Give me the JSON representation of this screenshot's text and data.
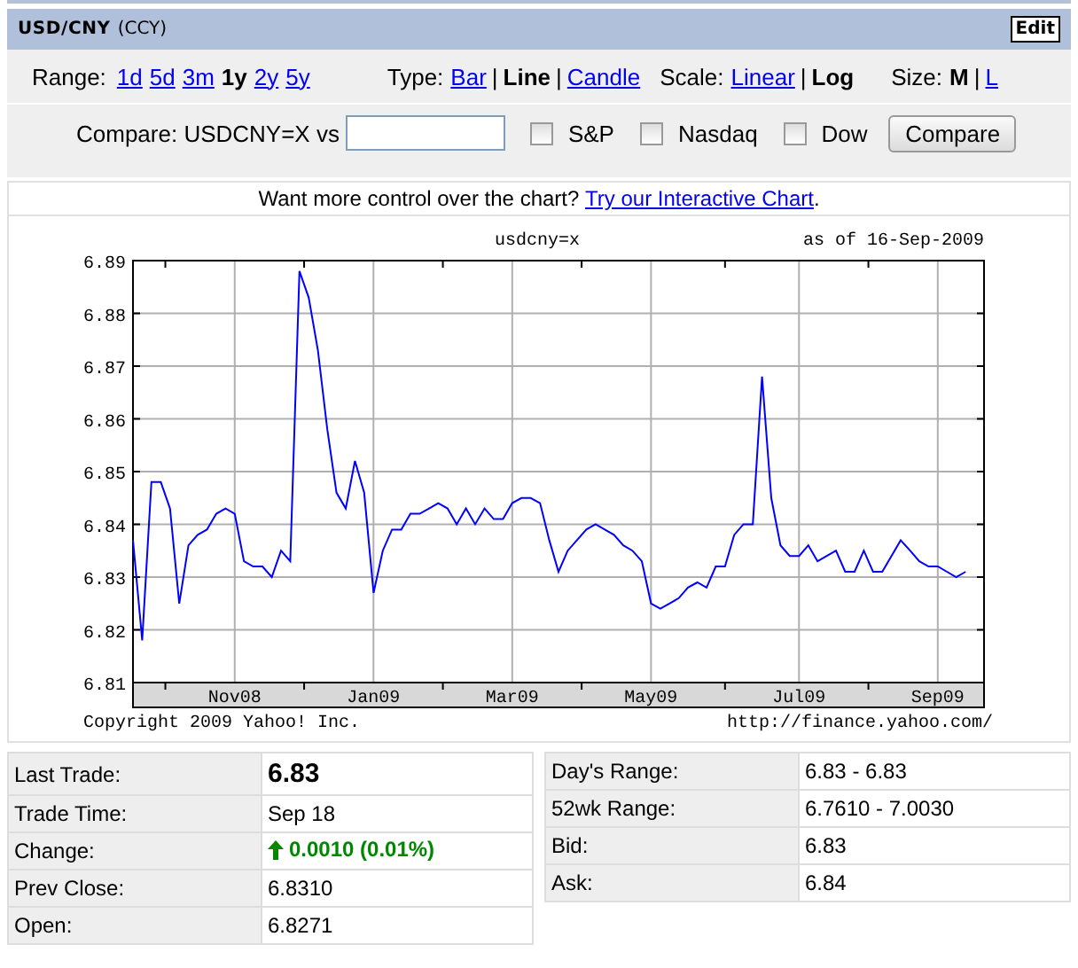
{
  "header": {
    "title": "USD/CNY",
    "subtitle": "(CCY)",
    "edit_button": "Edit"
  },
  "range": {
    "label": "Range:",
    "options": [
      {
        "label": "1d",
        "selected": false
      },
      {
        "label": "5d",
        "selected": false
      },
      {
        "label": "3m",
        "selected": false
      },
      {
        "label": "1y",
        "selected": true
      },
      {
        "label": "2y",
        "selected": false
      },
      {
        "label": "5y",
        "selected": false
      }
    ]
  },
  "chart_type": {
    "label": "Type:",
    "separator": "|",
    "options": [
      {
        "label": "Bar",
        "selected": false
      },
      {
        "label": "Line",
        "selected": true
      },
      {
        "label": "Candle",
        "selected": false
      }
    ]
  },
  "scale": {
    "label": "Scale:",
    "separator": "|",
    "options": [
      {
        "label": "Linear",
        "selected": false
      },
      {
        "label": "Log",
        "selected": true
      }
    ]
  },
  "size": {
    "label": "Size:",
    "separator": "|",
    "options": [
      {
        "label": "M",
        "selected": true
      },
      {
        "label": "L",
        "selected": false
      }
    ]
  },
  "compare": {
    "label": "Compare: USDCNY=X vs",
    "checkboxes": [
      {
        "label": "S&P",
        "checked": false
      },
      {
        "label": "Nasdaq",
        "checked": false
      },
      {
        "label": "Dow",
        "checked": false
      }
    ],
    "button": "Compare"
  },
  "promo": {
    "text": "Want more control over the chart?",
    "link": "Try our Interactive Chart",
    "tail": "."
  },
  "chart": {
    "as_of": "as of 16-Sep-2009",
    "copyright": "Copyright 2009 Yahoo! Inc.",
    "source": "http://finance.yahoo.com/",
    "chart_data": {
      "type": "line",
      "title": "usdcny=x",
      "grid": true,
      "ylim": [
        6.81,
        6.89
      ],
      "yticks": [
        6.81,
        6.82,
        6.83,
        6.84,
        6.85,
        6.86,
        6.87,
        6.88,
        6.89
      ],
      "categories": [
        null,
        null,
        null,
        null,
        null,
        null,
        null,
        null,
        null,
        null,
        null,
        "Nov08",
        null,
        null,
        null,
        null,
        null,
        null,
        null,
        null,
        null,
        null,
        null,
        null,
        null,
        null,
        "Jan09",
        null,
        null,
        null,
        null,
        null,
        null,
        null,
        null,
        null,
        null,
        null,
        null,
        null,
        null,
        "Mar09",
        null,
        null,
        null,
        null,
        null,
        null,
        null,
        null,
        null,
        null,
        null,
        null,
        null,
        null,
        "May09",
        null,
        null,
        null,
        null,
        null,
        null,
        null,
        null,
        null,
        null,
        null,
        null,
        null,
        null,
        null,
        "Jul09",
        null,
        null,
        null,
        null,
        null,
        null,
        null,
        null,
        null,
        null,
        null,
        null,
        null,
        null,
        "Sep09",
        null,
        null,
        null,
        null,
        null
      ],
      "series": [
        {
          "color": "#0000ff",
          "values": [
            6.837,
            6.818,
            6.848,
            6.848,
            6.843,
            6.825,
            6.836,
            6.838,
            6.839,
            6.842,
            6.843,
            6.842,
            6.833,
            6.832,
            6.832,
            6.83,
            6.835,
            6.833,
            6.888,
            6.883,
            6.873,
            6.858,
            6.846,
            6.843,
            6.852,
            6.846,
            6.827,
            6.835,
            6.839,
            6.839,
            6.842,
            6.842,
            6.843,
            6.844,
            6.843,
            6.84,
            6.843,
            6.84,
            6.843,
            6.841,
            6.841,
            6.844,
            6.845,
            6.845,
            6.844,
            6.837,
            6.831,
            6.835,
            6.837,
            6.839,
            6.84,
            6.839,
            6.838,
            6.836,
            6.835,
            6.833,
            6.825,
            6.824,
            6.825,
            6.826,
            6.828,
            6.829,
            6.828,
            6.832,
            6.832,
            6.838,
            6.84,
            6.84,
            6.868,
            6.845,
            6.836,
            6.834,
            6.834,
            6.836,
            6.833,
            6.834,
            6.835,
            6.831,
            6.831,
            6.835,
            6.831,
            6.831,
            6.834,
            6.837,
            6.835,
            6.833,
            6.832,
            6.832,
            6.831,
            6.83,
            6.831,
            null,
            null
          ]
        }
      ]
    }
  },
  "quote_left": [
    {
      "label": "Last Trade:",
      "value": "6.83",
      "kind": "price"
    },
    {
      "label": "Trade Time:",
      "value": "Sep 18",
      "kind": "plain"
    },
    {
      "label": "Change:",
      "value": "0.0010 (0.01%)",
      "kind": "change_up"
    },
    {
      "label": "Prev Close:",
      "value": "6.8310",
      "kind": "plain"
    },
    {
      "label": "Open:",
      "value": "6.8271",
      "kind": "plain"
    }
  ],
  "quote_right": [
    {
      "label": "Day's Range:",
      "value": "6.83 - 6.83",
      "kind": "plain"
    },
    {
      "label": "52wk Range:",
      "value": "6.7610 - 7.0030",
      "kind": "plain"
    },
    {
      "label": "Bid:",
      "value": "6.83",
      "kind": "plain"
    },
    {
      "label": "Ask:",
      "value": "6.84",
      "kind": "plain"
    }
  ]
}
